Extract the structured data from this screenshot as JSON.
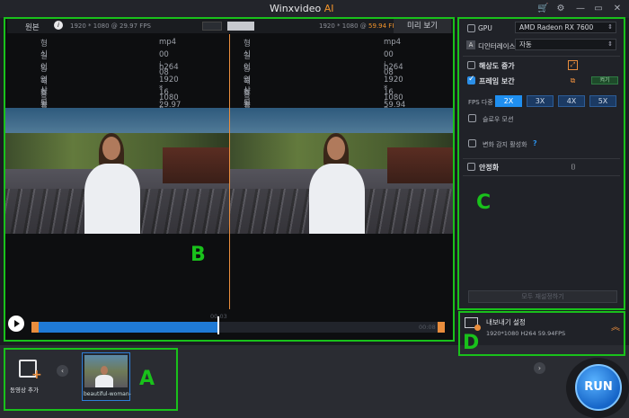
{
  "app": {
    "title_main": "Winxvideo",
    "title_ai": " AI"
  },
  "preview": {
    "left_label": "원본",
    "left_res": "1920 * 1080 @ 29.97 FPS",
    "right_res_prefix": "1920 * 1080 @ ",
    "right_fps": "59.94 FPS",
    "right_label": "미리 보기",
    "info_keys": [
      "형식",
      "길이",
      "동영상 코덱",
      "해상도",
      "종횡비",
      "프레임 속도"
    ],
    "left_values": [
      "mp4",
      "00 : 08",
      "h264",
      "1920 * 1080",
      "16 : 9",
      "29.97"
    ],
    "right_values": [
      "mp4",
      "00 : 08",
      "h264",
      "1920 * 1080",
      "16 : 9",
      "59.94"
    ]
  },
  "timeline": {
    "current": "00:03",
    "end": "00:08",
    "progress": 0.45
  },
  "settings": {
    "gpu_label": "GPU",
    "gpu_value": "AMD Radeon RX 7600",
    "deinterlace_label": "디인터레이스",
    "deinterlace_value": "자동",
    "upscale_label": "해상도 증가",
    "interp_label": "프레임 보간",
    "interp_toggle": "켜기",
    "fps_label": "FPS 다중",
    "fps_options": [
      "2X",
      "3X",
      "4X",
      "5X"
    ],
    "fps_selected": "2X",
    "slowmo_label": "슬로우 모션",
    "scene_label": "변화 감지 활성화",
    "help": "?",
    "stabilize_label": "안정화",
    "reset_label": "모두 재설정하기"
  },
  "export": {
    "title": "내보내기 설정",
    "info": "1920*1080   H264   59.94FPS"
  },
  "files": {
    "add_label": "동영상 추가",
    "thumb_name": "beautiful-woman-"
  },
  "run_label": "RUN",
  "annotations": [
    "A",
    "B",
    "C",
    "D"
  ],
  "colors": {
    "accent_orange": "#f0932b",
    "accent_blue": "#1f8ff0",
    "zone_green": "#19c11b"
  }
}
